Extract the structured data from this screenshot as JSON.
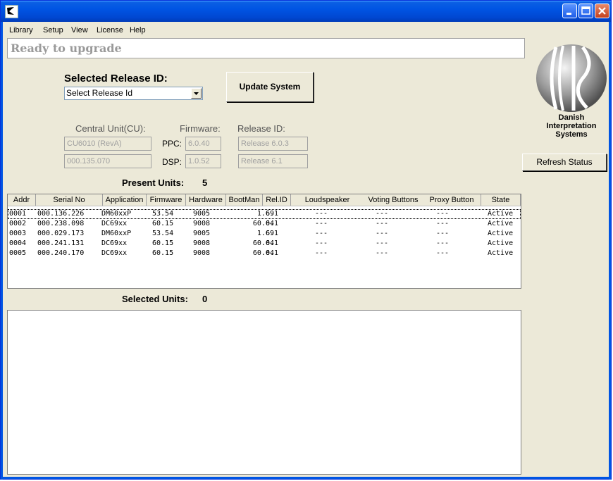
{
  "menu": [
    "Library",
    "Setup",
    "View",
    "License",
    "Help"
  ],
  "status": "Ready to upgrade",
  "logo": {
    "lines": [
      "Danish",
      "Interpretation",
      "Systems"
    ]
  },
  "release": {
    "label": "Selected Release ID:",
    "placeholder": "Select Release Id",
    "update_button": "Update System"
  },
  "refresh_button": "Refresh Status",
  "info": {
    "cu_label": "Central Unit(CU):",
    "firmware_label": "Firmware:",
    "release_label": "Release ID:",
    "ppc_label": "PPC:",
    "dsp_label": "DSP:",
    "cu_model": "CU6010 (RevA)",
    "cu_serial": "000.135.070",
    "ppc_value": "6.0.40",
    "dsp_value": "1.0.52",
    "release_ppc": "Release 6.0.3",
    "release_dsp": "Release 6.1"
  },
  "present": {
    "label": "Present Units:",
    "count": "5"
  },
  "selected": {
    "label": "Selected Units:",
    "count": "0"
  },
  "table": {
    "columns": [
      "Addr",
      "Serial No",
      "Application",
      "Firmware",
      "Hardware",
      "BootMan",
      "Rel.ID",
      "Loudspeaker",
      "Voting Buttons",
      "Proxy Button",
      "State"
    ],
    "rows": [
      [
        "0001",
        "000.136.226",
        "DM60xxP",
        "53.54",
        "9005",
        "1.69",
        "6.1",
        "---",
        "---",
        "---",
        "Active"
      ],
      [
        "0002",
        "000.238.098",
        "DC69xx",
        "60.15",
        "9008",
        "60.04",
        "6.1",
        "---",
        "---",
        "---",
        "Active"
      ],
      [
        "0003",
        "000.029.173",
        "DM60xxP",
        "53.54",
        "9005",
        "1.69",
        "6.1",
        "---",
        "---",
        "---",
        "Active"
      ],
      [
        "0004",
        "000.241.131",
        "DC69xx",
        "60.15",
        "9008",
        "60.04",
        "6.1",
        "---",
        "---",
        "---",
        "Active"
      ],
      [
        "0005",
        "000.240.170",
        "DC69xx",
        "60.15",
        "9008",
        "60.04",
        "6.1",
        "---",
        "---",
        "---",
        "Active"
      ]
    ]
  },
  "colors": {
    "titlebar": "#0054e3",
    "window_bg": "#ece9d8",
    "status_text": "#9a9a9a"
  }
}
